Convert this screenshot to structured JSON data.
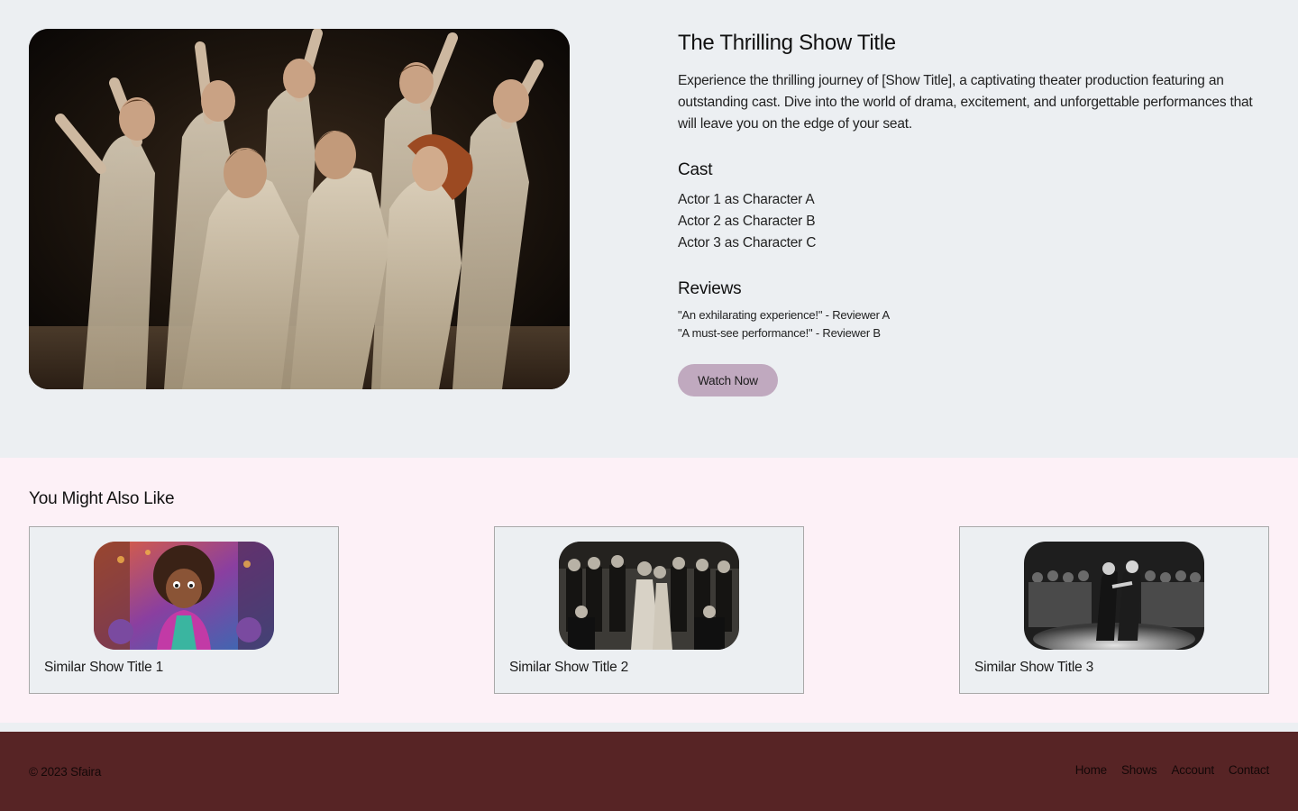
{
  "show": {
    "title": "The Thrilling Show Title",
    "description": "Experience the thrilling journey of [Show Title], a captivating theater production featuring an outstanding cast. Dive into the world of drama, excitement, and unforgettable performances that will leave you on the edge of your seat.",
    "hero_image": "theater-ensemble-photo",
    "cast_heading": "Cast",
    "cast": [
      "Actor 1 as Character A",
      "Actor 2 as Character B",
      "Actor 3 as Character C"
    ],
    "reviews_heading": "Reviews",
    "reviews": [
      "\"An exhilarating experience!\" - Reviewer A",
      "\"A must-see performance!\" - Reviewer B"
    ],
    "watch_label": "Watch Now"
  },
  "similar": {
    "heading": "You Might Also Like",
    "cards": [
      {
        "title": "Similar Show Title 1",
        "image": "animated-character-thumbnail"
      },
      {
        "title": "Similar Show Title 2",
        "image": "vintage-ensemble-thumbnail"
      },
      {
        "title": "Similar Show Title 3",
        "image": "stage-duel-thumbnail"
      }
    ]
  },
  "footer": {
    "copyright": "© 2023 Sfaira",
    "nav": [
      "Home",
      "Shows",
      "Account",
      "Contact"
    ]
  },
  "colors": {
    "page_bg": "#eceff2",
    "similar_bg": "#fdf1f7",
    "button_bg": "#c0a9bf",
    "footer_bg": "#572425",
    "card_border": "#a9a9a9"
  }
}
